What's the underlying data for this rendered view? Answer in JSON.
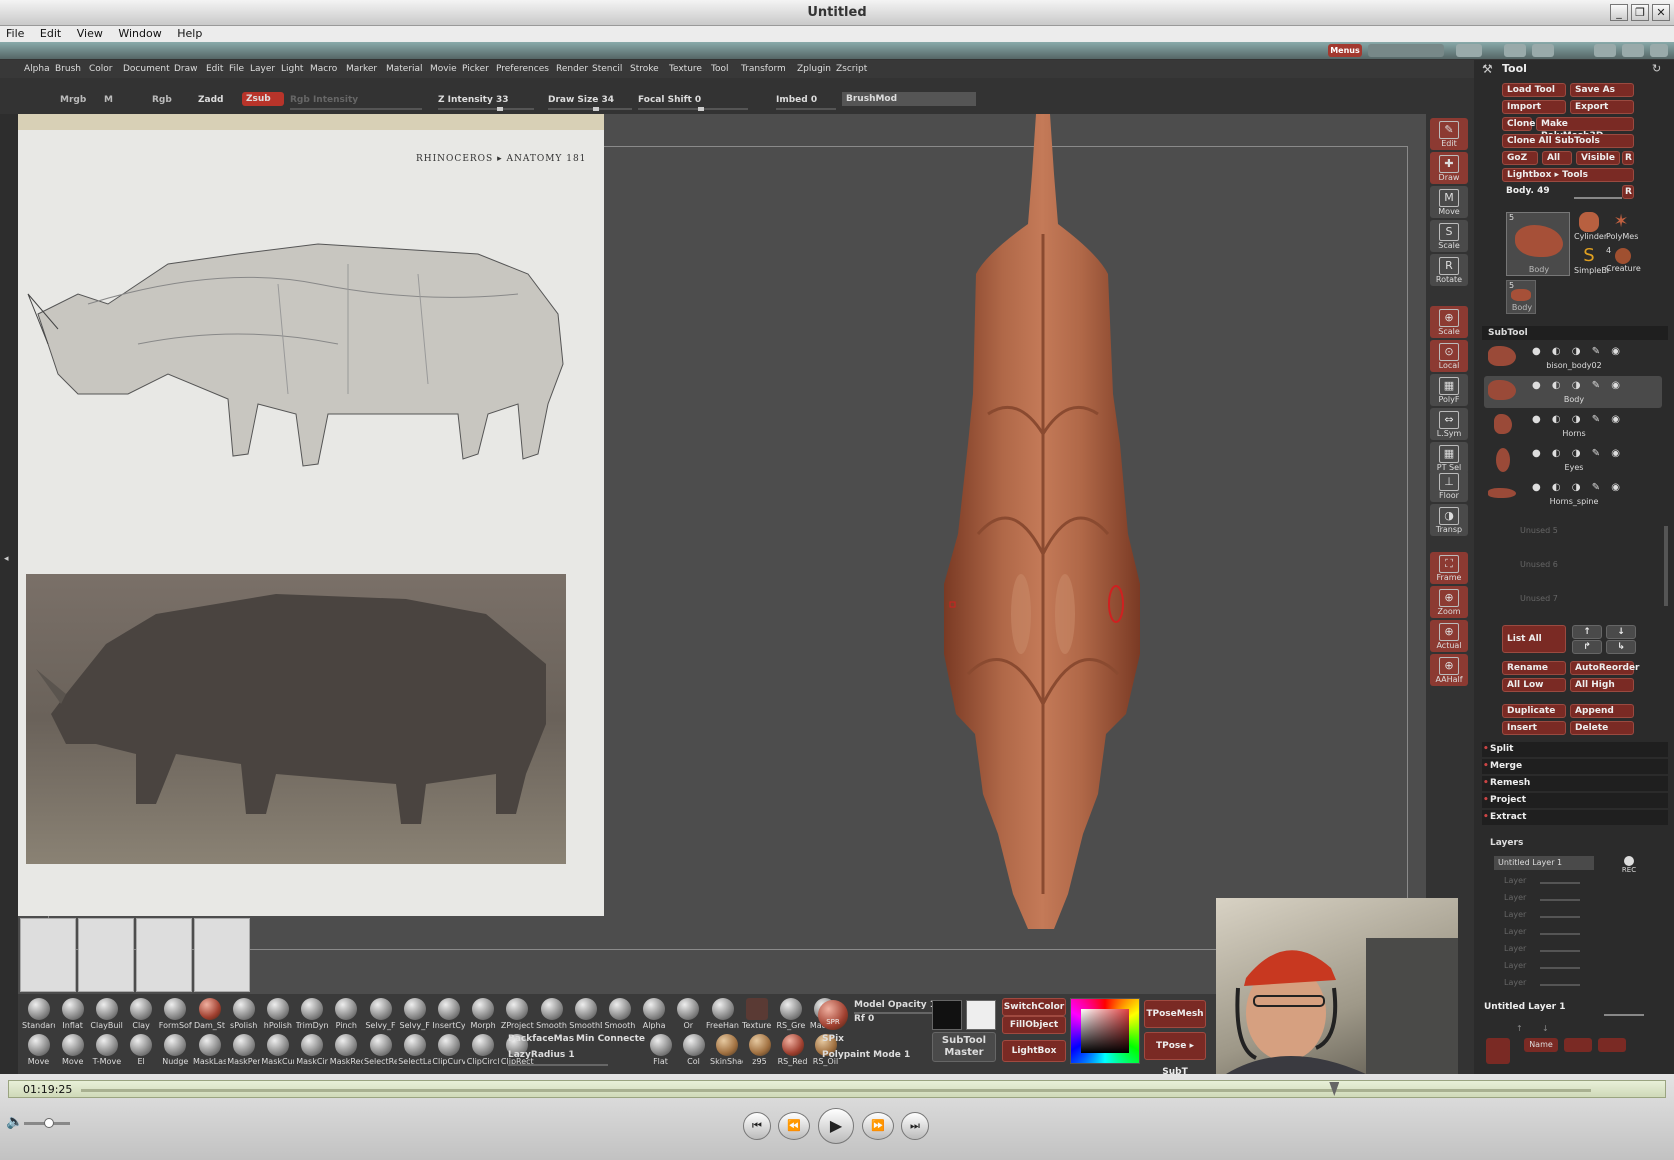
{
  "window": {
    "title": "Untitled",
    "buttons": [
      "_",
      "❐",
      "✕"
    ]
  },
  "os_menu": [
    "File",
    "Edit",
    "View",
    "Window",
    "Help"
  ],
  "zb_top": {
    "menus_label": "Menus"
  },
  "zb_menus": [
    "Alpha",
    "Brush",
    "Color",
    "Document",
    "Draw",
    "Edit",
    "File",
    "Layer",
    "Light",
    "Macro",
    "Marker",
    "Material",
    "Movie",
    "Picker",
    "Preferences",
    "Render",
    "Stencil",
    "Stroke",
    "Texture",
    "Tool",
    "Transform",
    "Zplugin",
    "Zscript"
  ],
  "shelf": {
    "mrgb": "Mrgb",
    "m": "M",
    "rgb": "Rgb",
    "zadd": "Zadd",
    "zsub": "Zsub",
    "rgb_intensity": "Rgb Intensity",
    "z_intensity": "Z Intensity 33",
    "draw_size": "Draw Size 34",
    "focal_shift": "Focal Shift 0",
    "imbed": "Imbed 0",
    "brushmod": "BrushMod"
  },
  "reference": {
    "header": "RHINOCEROS  ▸  ANATOMY   181"
  },
  "right_icons": [
    {
      "name": "edit",
      "label": "Edit",
      "glyph": "✎",
      "active": true
    },
    {
      "name": "draw",
      "label": "Draw",
      "glyph": "✚",
      "active": true
    },
    {
      "name": "move",
      "label": "Move",
      "glyph": "M",
      "active": false
    },
    {
      "name": "scale",
      "label": "Scale",
      "glyph": "S",
      "active": false
    },
    {
      "name": "rotate",
      "label": "Rotate",
      "glyph": "R",
      "active": false
    },
    {
      "name": "scale-view",
      "label": "Scale",
      "glyph": "⊕",
      "active": true
    },
    {
      "name": "local",
      "label": "Local",
      "glyph": "⊙",
      "active": true
    },
    {
      "name": "polyf",
      "label": "PolyF",
      "glyph": "▦",
      "active": false
    },
    {
      "name": "lsym",
      "label": "L.Sym",
      "glyph": "⇔",
      "active": false
    },
    {
      "name": "ptsel",
      "label": "PT Sel",
      "glyph": "▦",
      "active": false
    },
    {
      "name": "floor",
      "label": "Floor",
      "glyph": "⊥",
      "active": false
    },
    {
      "name": "transp",
      "label": "Transp",
      "glyph": "◑",
      "active": false
    },
    {
      "name": "frame",
      "label": "Frame",
      "glyph": "⛶",
      "active": true
    },
    {
      "name": "zoom",
      "label": "Zoom",
      "glyph": "⊕",
      "active": true
    },
    {
      "name": "actual",
      "label": "Actual",
      "glyph": "⊕",
      "active": true
    },
    {
      "name": "aahalf",
      "label": "AAHalf",
      "glyph": "⊕",
      "active": true
    }
  ],
  "tool": {
    "title": "Tool",
    "load_tool": "Load Tool",
    "save_as": "Save As",
    "import": "Import",
    "export": "Export",
    "clone": "Clone",
    "make_polymesh": "Make PolyMesh3D",
    "clone_all": "Clone All SubTools",
    "goz": "GoZ",
    "all": "All",
    "visible": "Visible",
    "r": "R",
    "lightbox_tools": "Lightbox ▸ Tools",
    "current": "Body. 49",
    "thumbs": [
      "Body",
      "Cylinder",
      "PolyMes",
      "SimpleBr",
      "Creature",
      "Body"
    ],
    "thumb_count_a": "5",
    "thumb_count_b": "5",
    "thumb_count_c": "4",
    "subtool_title": "SubTool",
    "subtools": [
      "bison_body02",
      "Body",
      "Horns",
      "Eyes",
      "Horns_spine"
    ],
    "unused": [
      "Unused 5",
      "Unused 6",
      "Unused 7"
    ],
    "list_all": "List All",
    "rename": "Rename",
    "autoreorder": "AutoReorder",
    "all_low": "All Low",
    "all_high": "All High",
    "duplicate": "Duplicate",
    "append": "Append",
    "insert": "Insert",
    "delete": "Delete",
    "sections": [
      "Split",
      "Merge",
      "Remesh",
      "Project",
      "Extract"
    ],
    "layers_title": "Layers",
    "layer_name": "Untitled Layer 1",
    "rec": "REC",
    "layer_rows": [
      "Layer",
      "Layer",
      "Layer",
      "Layer",
      "Layer",
      "Layer",
      "Layer"
    ],
    "layer_footer": "Untitled Layer 1",
    "name_btn": "Name"
  },
  "bottom": {
    "brushes_row1": [
      "Standard",
      "Inflat",
      "ClayBuild",
      "Clay",
      "FormSoft",
      "Dam_St",
      "sPolish",
      "hPolish",
      "TrimDyn",
      "Pinch",
      "Selvy_F",
      "Selvy_F",
      "InsertCy",
      "Morph",
      "ZProject",
      "Smooth",
      "SmoothD",
      "Smooth",
      "Alpha",
      "Or",
      "FreeHan",
      "Texture",
      "RS_Gre",
      "MatCap"
    ],
    "brushes_row2": [
      "Move",
      "Move",
      "T-Move",
      "El",
      "Nudge",
      "MaskLas",
      "MaskPer",
      "MaskCur",
      "MaskCir",
      "MaskRec",
      "SelectRe",
      "SelectLa",
      "ClipCurv",
      "ClipCircl",
      "ClipRect"
    ],
    "backface": "BackfaceMas",
    "min_connected": "Min Connecte",
    "lazy_radius": "LazyRadius 1",
    "materials": [
      "Flat",
      "Col",
      "SkinShad",
      "z95",
      "RS_Red",
      "RS_Oil"
    ],
    "spr": "SPR",
    "model_opacity": "Model Opacity 1",
    "rf": "Rf 0",
    "spix": "SPix",
    "polypaint_mode": "Polypaint Mode 1",
    "subtool_master": "SubTool Master",
    "switch_color": "SwitchColor",
    "fill_object": "FillObject",
    "lightbox": "LightBox",
    "tposemesh": "TPoseMesh",
    "tpose_subt": "TPose ▸ SubT"
  },
  "player": {
    "time": "01:19:25",
    "progress": 0.83,
    "volume": 0.55,
    "controls": [
      "⏮",
      "⏪",
      "▶",
      "⏩",
      "⏭"
    ]
  }
}
